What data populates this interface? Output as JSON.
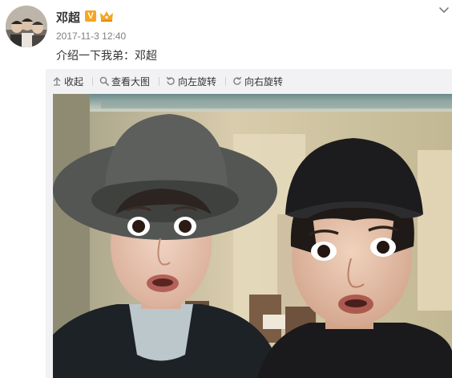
{
  "post": {
    "username": "邓超",
    "verified_badge": "V",
    "timestamp": "2017-11-3 12:40",
    "text": "介绍一下我弟：邓超"
  },
  "icons": {
    "verified": "verified-v-badge",
    "member": "crown-icon",
    "menu": "chevron-down-icon",
    "collapse": "arrow-up-icon",
    "zoom": "magnifier-icon",
    "rotate_left": "rotate-left-icon",
    "rotate_right": "rotate-right-icon"
  },
  "toolbar": {
    "collapse_label": "收起",
    "view_large_label": "查看大图",
    "rotate_left_label": "向左旋转",
    "rotate_right_label": "向右旋转"
  },
  "colors": {
    "text": "#333333",
    "meta": "#808080",
    "badge": "#f5a623",
    "panel_bg": "#f2f2f5"
  }
}
